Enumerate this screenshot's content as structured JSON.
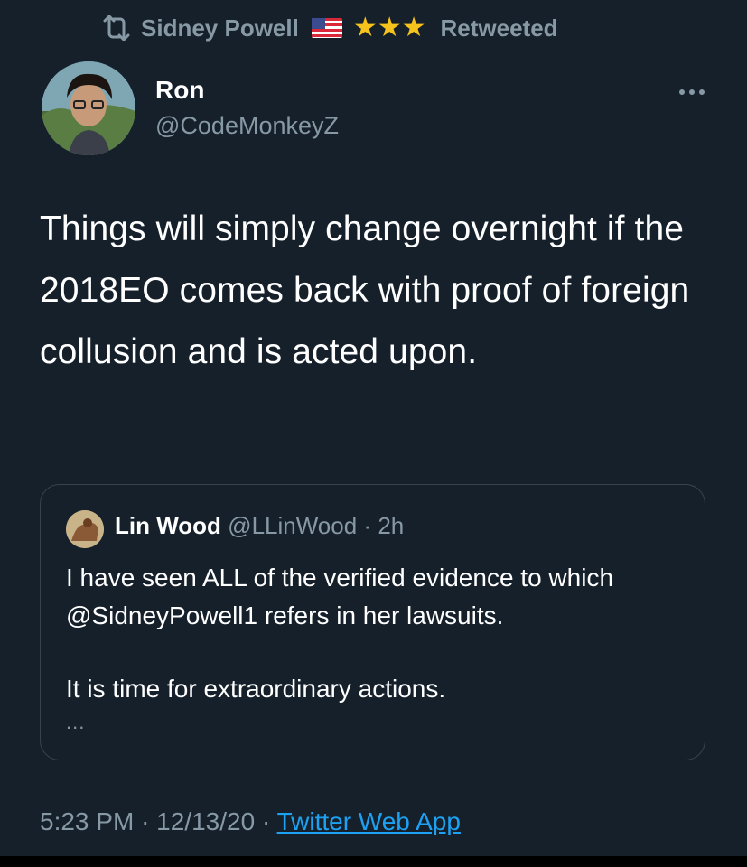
{
  "retweet": {
    "user": "Sidney Powell",
    "flag_icon": "us-flag-icon",
    "stars": "★★★",
    "label": "Retweeted"
  },
  "author": {
    "name": "Ron",
    "handle": "@CodeMonkeyZ"
  },
  "tweet": {
    "text": "Things will simply change overnight if the 2018EO comes back with proof of foreign collusion and is acted upon."
  },
  "quote": {
    "name": "Lin Wood",
    "handle": "@LLinWood",
    "separator": "·",
    "time": "2h",
    "line1": "I have seen ALL of the verified evidence to which @SidneyPowell1 refers in her lawsuits.",
    "line2": "It is time for extraordinary actions.",
    "more": "..."
  },
  "meta": {
    "time": "5:23 PM",
    "sep1": "·",
    "date": "12/13/20",
    "sep2": "·",
    "source": "Twitter Web App"
  },
  "colors": {
    "background": "#15202b",
    "muted": "#8899a6",
    "link": "#1da1f2",
    "border": "#38444d",
    "star": "#f6c21c"
  }
}
